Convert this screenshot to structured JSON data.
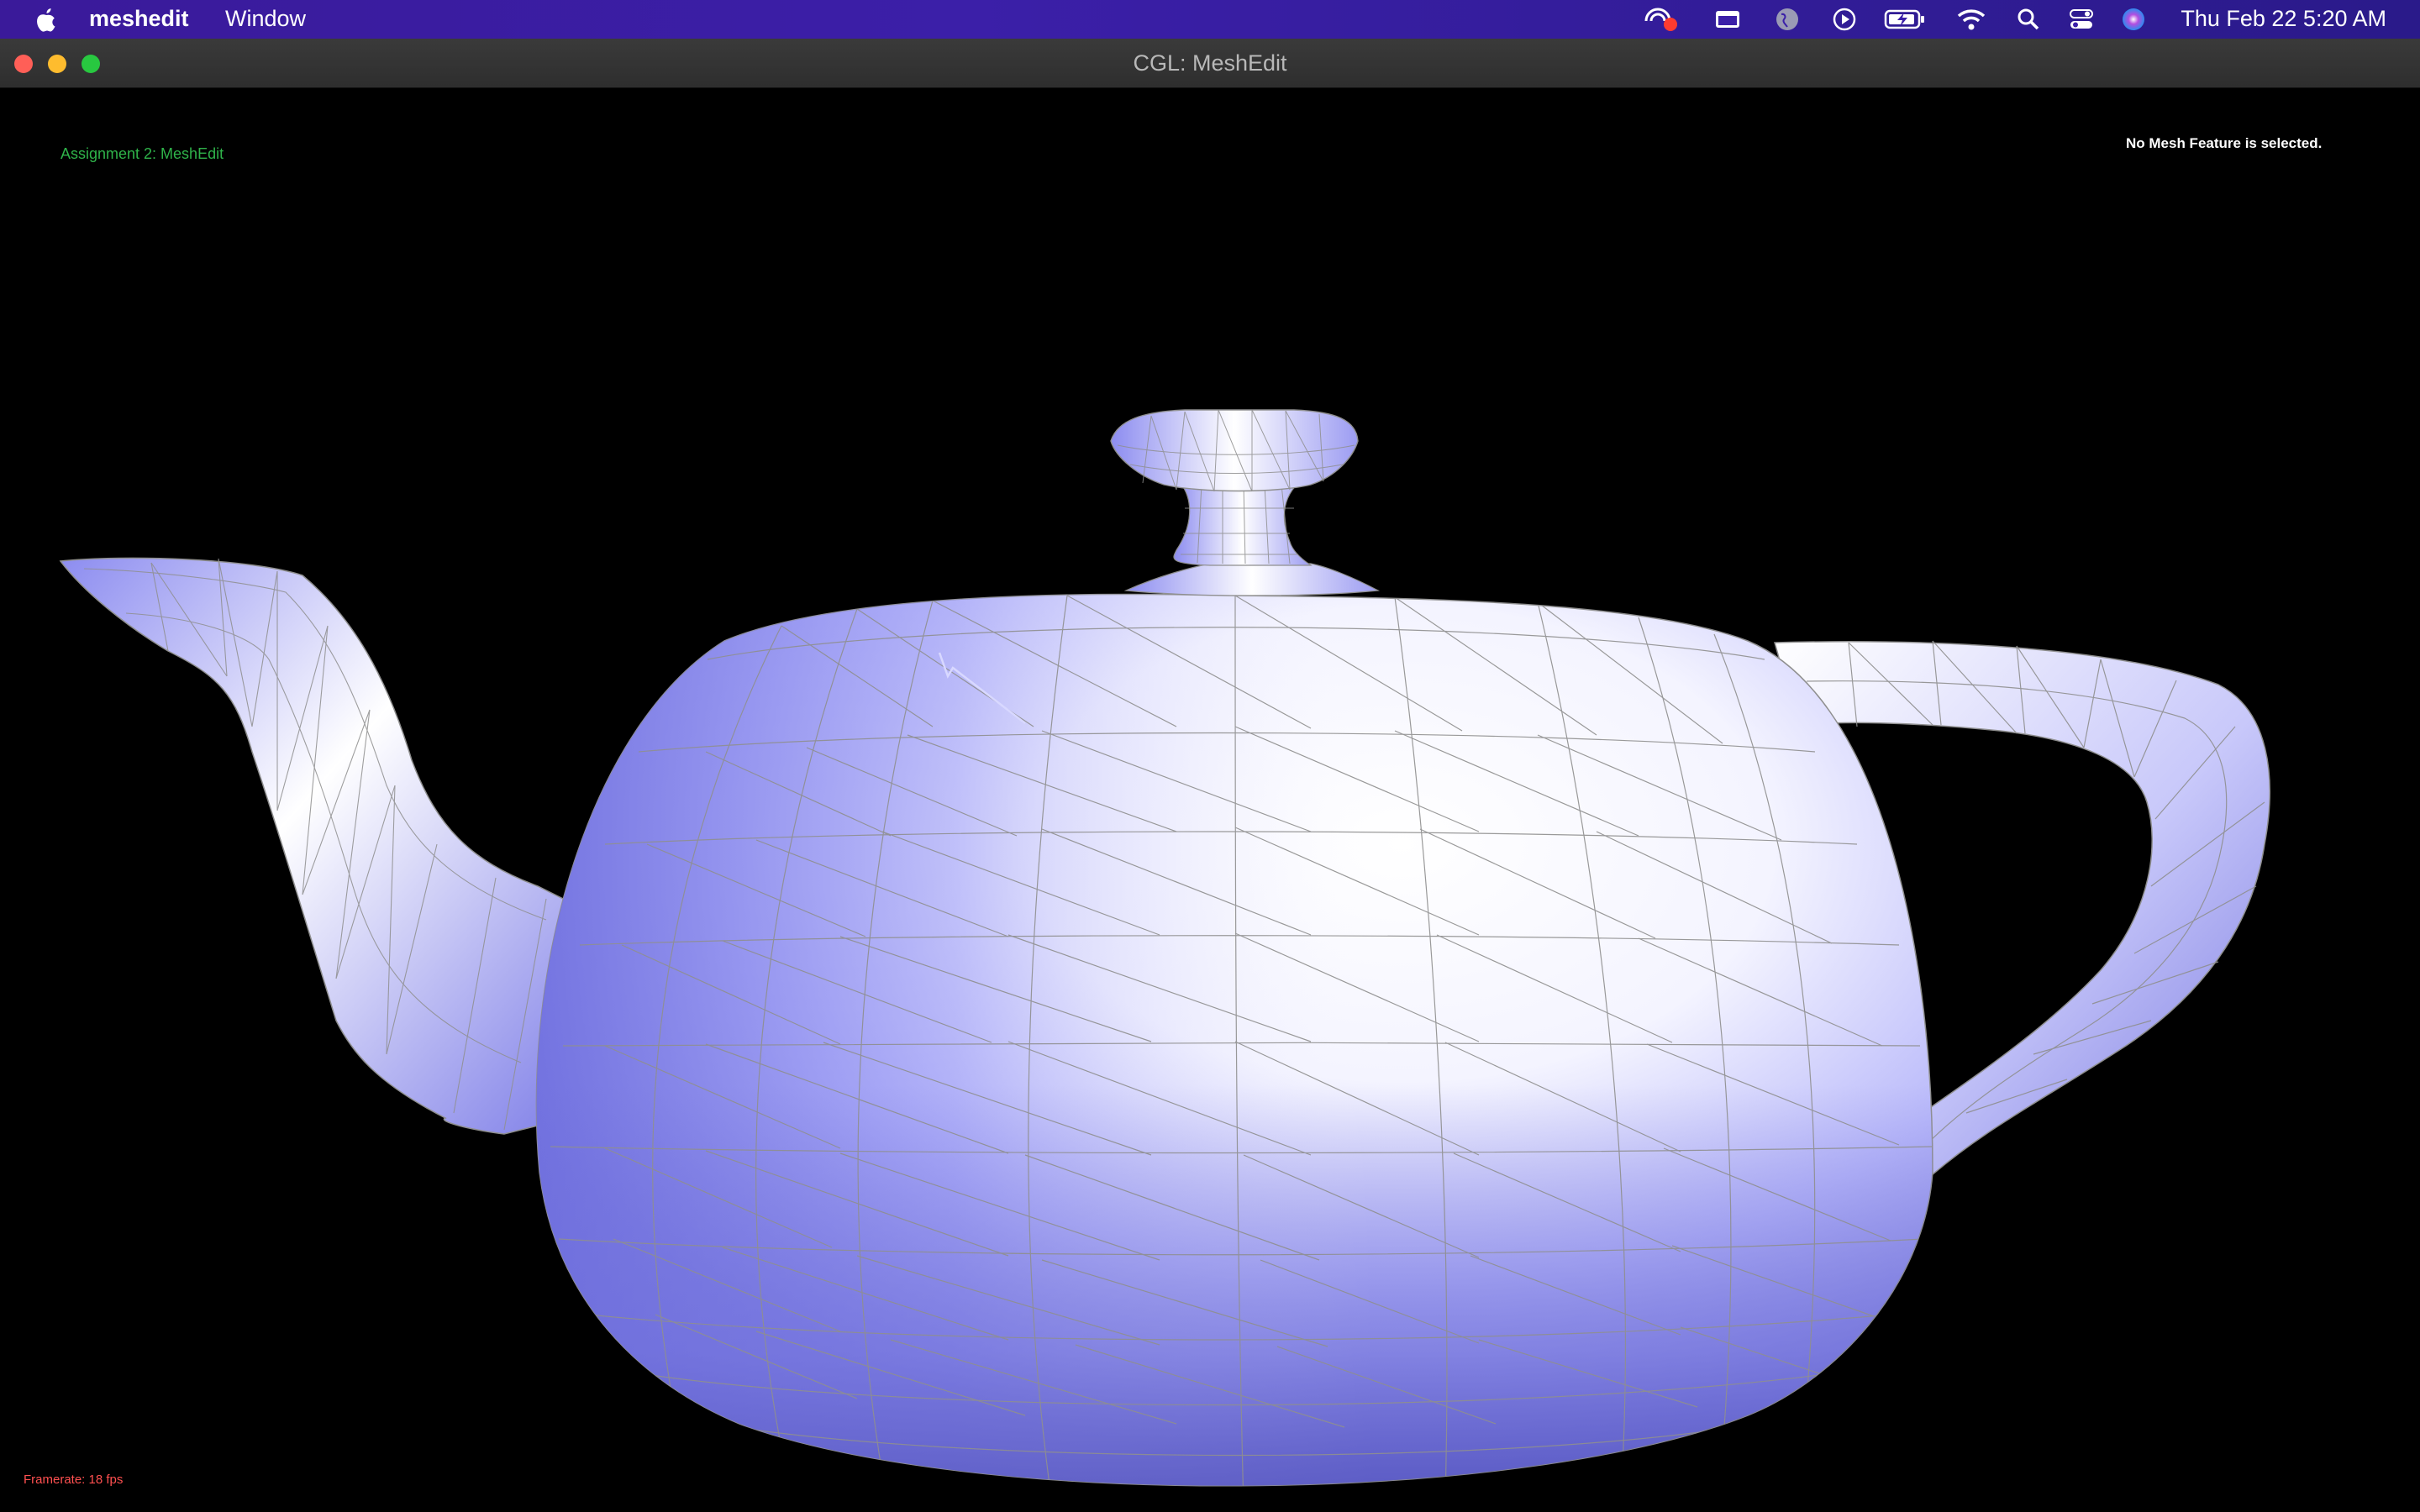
{
  "menubar": {
    "app_name": "meshedit",
    "menus": [
      "Window"
    ],
    "clock": "Thu Feb 22  5:20 AM",
    "status_icons": [
      "screen-recording-icon",
      "media-icon",
      "globe-icon",
      "play-circle-icon",
      "battery-charging-icon",
      "wifi-icon",
      "search-icon",
      "control-center-icon",
      "siri-icon"
    ]
  },
  "window": {
    "title": "CGL: MeshEdit"
  },
  "viewport": {
    "hud_title": "Assignment 2: MeshEdit",
    "hud_status": "No Mesh Feature is selected.",
    "framerate": "Framerate: 18 fps",
    "colors": {
      "background": "#000000",
      "mesh_fill_light": "#ffffff",
      "mesh_fill_dark": "#8a8af5",
      "wireframe": "#8f8f8f",
      "hud_title": "#2fb34a",
      "framerate": "#ff5050"
    }
  }
}
